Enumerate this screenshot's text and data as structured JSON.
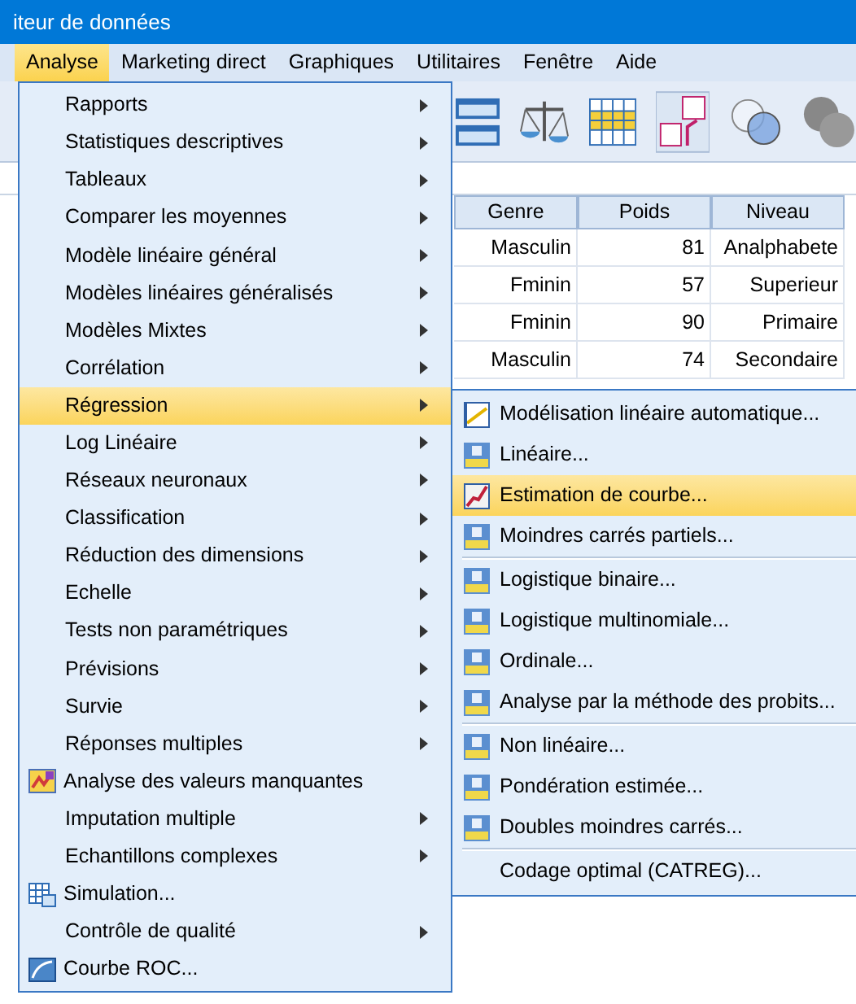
{
  "window": {
    "title": "iteur de données"
  },
  "menubar": [
    {
      "label": "Analyse",
      "selected": true
    },
    {
      "label": "Marketing direct",
      "selected": false
    },
    {
      "label": "Graphiques",
      "selected": false
    },
    {
      "label": "Utilitaires",
      "selected": false
    },
    {
      "label": "Fenêtre",
      "selected": false
    },
    {
      "label": "Aide",
      "selected": false
    }
  ],
  "table": {
    "columns": [
      "Genre",
      "Poids",
      "Niveau"
    ],
    "rows": [
      [
        "Masculin",
        "81",
        "Analphabete"
      ],
      [
        "Fminin",
        "57",
        "Superieur"
      ],
      [
        "Fminin",
        "90",
        "Primaire"
      ],
      [
        "Masculin",
        "74",
        "Secondaire"
      ]
    ]
  },
  "analyse_menu": {
    "items": [
      {
        "label": "Rapports",
        "kind": "submenu",
        "selected": false
      },
      {
        "label": "Statistiques descriptives",
        "kind": "submenu",
        "selected": false
      },
      {
        "label": "Tableaux",
        "kind": "submenu",
        "selected": false
      },
      {
        "label": "Comparer les moyennes",
        "kind": "submenu",
        "selected": false
      },
      {
        "label": "Modèle linéaire général",
        "kind": "submenu",
        "selected": false
      },
      {
        "label": "Modèles linéaires généralisés",
        "kind": "submenu",
        "selected": false
      },
      {
        "label": "Modèles Mixtes",
        "kind": "submenu",
        "selected": false
      },
      {
        "label": "Corrélation",
        "kind": "submenu",
        "selected": false
      },
      {
        "label": "Régression",
        "kind": "submenu",
        "selected": true
      },
      {
        "label": "Log Linéaire",
        "kind": "submenu",
        "selected": false
      },
      {
        "label": "Réseaux neuronaux",
        "kind": "submenu",
        "selected": false
      },
      {
        "label": "Classification",
        "kind": "submenu",
        "selected": false
      },
      {
        "label": "Réduction des dimensions",
        "kind": "submenu",
        "selected": false
      },
      {
        "label": "Echelle",
        "kind": "submenu",
        "selected": false
      },
      {
        "label": "Tests non paramétriques",
        "kind": "submenu",
        "selected": false
      },
      {
        "label": "Prévisions",
        "kind": "submenu",
        "selected": false
      },
      {
        "label": "Survie",
        "kind": "submenu",
        "selected": false
      },
      {
        "label": "Réponses multiples",
        "kind": "submenu",
        "selected": false
      },
      {
        "label": "Analyse des valeurs manquantes",
        "kind": "command",
        "selected": false
      },
      {
        "label": "Imputation multiple",
        "kind": "submenu",
        "selected": false
      },
      {
        "label": "Echantillons complexes",
        "kind": "submenu",
        "selected": false
      },
      {
        "label": "Simulation...",
        "kind": "command",
        "selected": false
      },
      {
        "label": "Contrôle de qualité",
        "kind": "submenu",
        "selected": false
      },
      {
        "label": "Courbe ROC...",
        "kind": "command",
        "selected": false
      }
    ]
  },
  "regression_submenu": {
    "items": [
      {
        "label": "Modélisation linéaire automatique...",
        "selected": false,
        "separator_before": false
      },
      {
        "label": "Linéaire...",
        "selected": false,
        "separator_before": false
      },
      {
        "label": "Estimation de courbe...",
        "selected": true,
        "separator_before": false
      },
      {
        "label": "Moindres carrés partiels...",
        "selected": false,
        "separator_before": false
      },
      {
        "label": "Logistique binaire...",
        "selected": false,
        "separator_before": true
      },
      {
        "label": "Logistique multinomiale...",
        "selected": false,
        "separator_before": false
      },
      {
        "label": "Ordinale...",
        "selected": false,
        "separator_before": false
      },
      {
        "label": "Analyse par la méthode des probits...",
        "selected": false,
        "separator_before": false
      },
      {
        "label": "Non linéaire...",
        "selected": false,
        "separator_before": true
      },
      {
        "label": "Pondération estimée...",
        "selected": false,
        "separator_before": false
      },
      {
        "label": "Doubles moindres carrés...",
        "selected": false,
        "separator_before": false
      },
      {
        "label": "Codage optimal (CATREG)...",
        "selected": false,
        "separator_before": true
      }
    ]
  }
}
